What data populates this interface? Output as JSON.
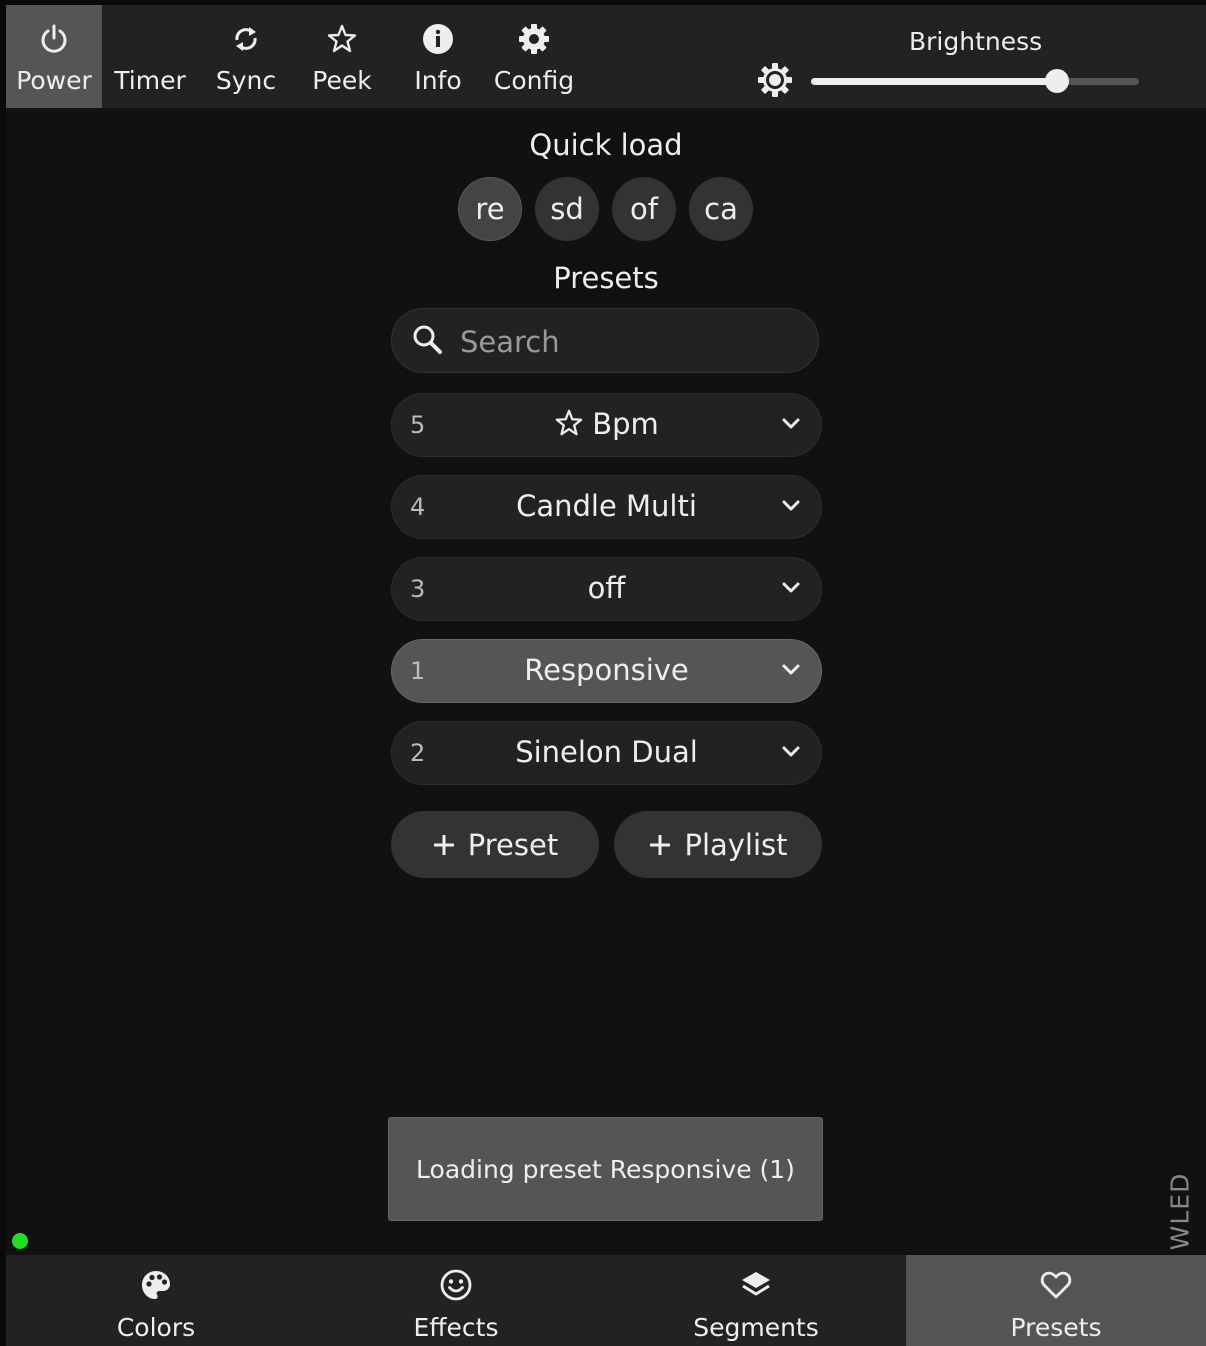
{
  "topbar": {
    "buttons": [
      {
        "label": "Power",
        "icon": "power-icon",
        "active": true
      },
      {
        "label": "Timer",
        "icon": "moon-icon",
        "active": false
      },
      {
        "label": "Sync",
        "icon": "sync-icon",
        "active": false
      },
      {
        "label": "Peek",
        "icon": "star-icon",
        "active": false
      },
      {
        "label": "Info",
        "icon": "info-icon",
        "active": false
      },
      {
        "label": "Config",
        "icon": "gear-icon",
        "active": false
      }
    ],
    "brightness": {
      "title": "Brightness",
      "icon": "brightness-icon",
      "value_fraction": 0.75
    }
  },
  "quick_load": {
    "title": "Quick load",
    "items": [
      {
        "label": "re",
        "active": true
      },
      {
        "label": "sd",
        "active": false
      },
      {
        "label": "of",
        "active": false
      },
      {
        "label": "ca",
        "active": false
      }
    ]
  },
  "presets": {
    "title": "Presets",
    "search_placeholder": "Search",
    "list": [
      {
        "id": "5",
        "name": "Bpm",
        "favorite": true,
        "active": false
      },
      {
        "id": "4",
        "name": "Candle Multi",
        "favorite": false,
        "active": false
      },
      {
        "id": "3",
        "name": "off",
        "favorite": false,
        "active": false
      },
      {
        "id": "1",
        "name": "Responsive",
        "favorite": false,
        "active": true
      },
      {
        "id": "2",
        "name": "Sinelon Dual",
        "favorite": false,
        "active": false
      }
    ],
    "add_preset_label": "Preset",
    "add_playlist_label": "Playlist"
  },
  "toast": {
    "text": "Loading preset Responsive (1)"
  },
  "brand": "WLED",
  "connection_status_color": "#22dd22",
  "bottom_nav": [
    {
      "label": "Colors",
      "icon": "palette-icon",
      "active": false
    },
    {
      "label": "Effects",
      "icon": "smiley-icon",
      "active": false
    },
    {
      "label": "Segments",
      "icon": "layers-icon",
      "active": false
    },
    {
      "label": "Presets",
      "icon": "heart-icon",
      "active": true
    }
  ],
  "colors": {
    "background": "#111111",
    "panel": "#222222",
    "active": "#555555",
    "text": "#eeeeee"
  }
}
